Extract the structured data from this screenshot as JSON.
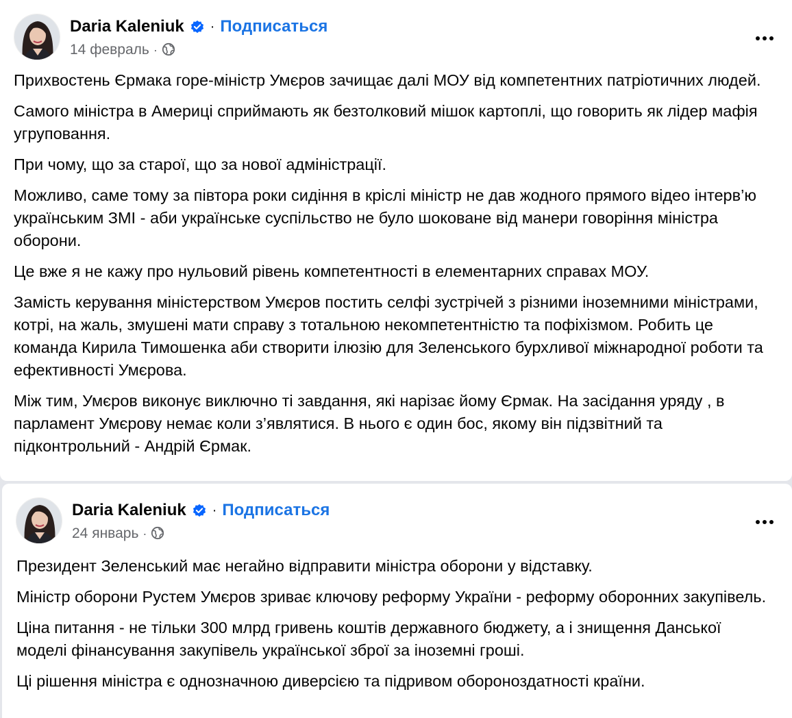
{
  "posts": [
    {
      "author": "Daria Kaleniuk",
      "separator": "·",
      "subscribe_label": "Подписаться",
      "date": "14 февраль",
      "meta_separator": "·",
      "audience_icon": "globe-icon",
      "more_icon": "more-options-icon",
      "paragraphs": [
        "Прихвостень Єрмака горе-міністр Умєров зачищає далі МОУ від компетентних патріотичних людей.",
        "Самого міністра в Америці сприймають як безтолковий мішок картоплі, що говорить як лідер мафія угруповання.",
        "При чому, що за старої, що за нової адміністрації.",
        "Можливо, саме тому за півтора роки сидіння в кріслі міністр не дав жодного прямого відео інтерв’ю українським ЗМІ - аби українське суспільство не було шоковане від манери говоріння міністра оборони.",
        "Це вже я не кажу про нульовий рівень компетентності в елементарних справах МОУ.",
        "Замість керування міністерством Умєров постить селфі зустрічей з різними іноземними міністрами, котрі, на жаль, змушені мати справу з тотальною некомпетентністю та пофіхізмом. Робить це команда Кирила Тимошенка аби створити ілюзію для Зеленського бурхливої міжнародної роботи та ефективності Умєрова.",
        "Між тим, Умєров виконує виключно ті завдання, які нарізає йому Єрмак. На засідання уряду , в парламент Умєрову немає коли з’являтися. В нього є один бос, якому він підзвітний та підконтрольний - Андрій Єрмак."
      ]
    },
    {
      "author": "Daria Kaleniuk",
      "separator": "·",
      "subscribe_label": "Подписаться",
      "date": "24 январь",
      "meta_separator": "·",
      "audience_icon": "globe-icon",
      "more_icon": "more-options-icon",
      "paragraphs": [
        "Президент Зеленський має негайно відправити міністра оборони у відставку.",
        "Міністр оборони Рустем Умєров зриває ключову реформу України - реформу оборонних закупівель.",
        "Ціна питання - не тільки 300 млрд гривень коштів державного бюджету, а і знищення Данської моделі фінансування закупівель української зброї за іноземні гроші.",
        "Ці рішення міністра є однозначною диверсією та підривом обороноздатності країни."
      ]
    }
  ],
  "colors": {
    "link": "#1b74e4",
    "verified": "#0866ff",
    "secondary_text": "#65676b",
    "background": "#e4e6eb"
  }
}
